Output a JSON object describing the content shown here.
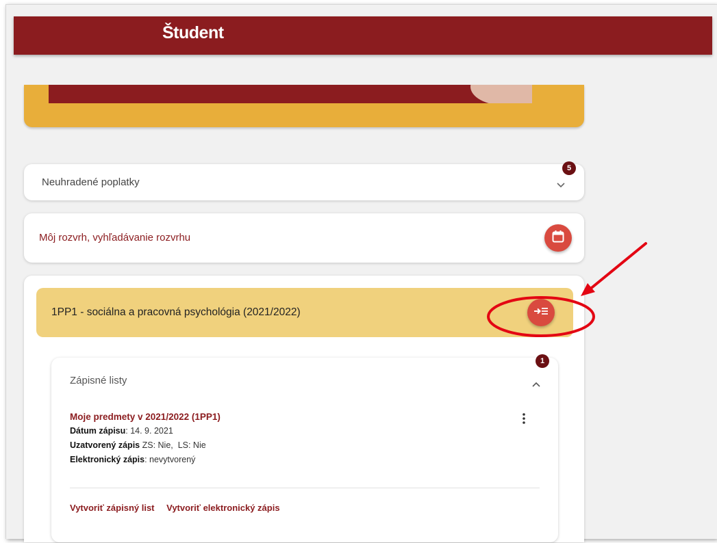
{
  "header": {
    "title": "Študent"
  },
  "fees": {
    "label": "Neuhradené poplatky",
    "badge": "5"
  },
  "schedule": {
    "label": "Môj rozvrh, vyhľadávanie rozvrhu"
  },
  "study": {
    "label": "1PP1 - sociálna a pracovná psychológia (2021/2022)"
  },
  "enrollment": {
    "title": "Zápisné listy",
    "badge": "1",
    "sheet_title": "Moje predmety v 2021/2022 (1PP1)",
    "date_label": "Dátum zápisu",
    "date_value": ": 14. 9. 2021",
    "closed_label": "Uzatvorený zápis",
    "closed_value": " ZS: Nie,  LS: Nie",
    "electronic_label": "Elektronický zápis",
    "electronic_value": ": nevytvorený",
    "action_create_sheet": "Vytvoriť zápisný list",
    "action_create_electronic": "Vytvoriť elektronický zápis"
  },
  "colors": {
    "brand": "#8b1c1f",
    "banner": "#e8ae3a",
    "study_header": "#f0d17d",
    "action_button": "#d94a3f",
    "annotation": "#e30613"
  },
  "icons": {
    "fees_toggle": "chevron-down-icon",
    "schedule_button": "calendar-icon",
    "study_button": "enter-list-icon",
    "enrollment_toggle": "chevron-up-icon",
    "sheet_menu": "kebab-menu-icon"
  }
}
